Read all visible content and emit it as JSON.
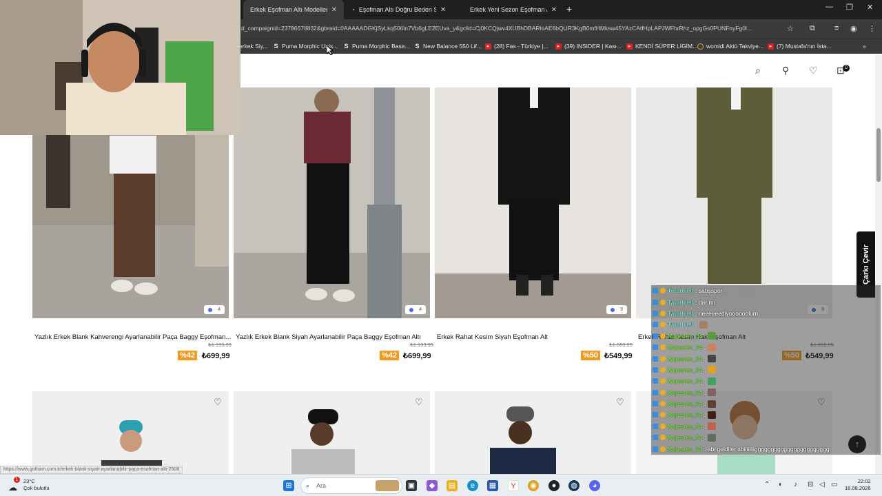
{
  "browser": {
    "tabs": [
      {
        "label": "Erkek Eşofman Altı Modelleri | G",
        "active": true
      },
      {
        "label": "Eşofman Altı Doğru Beden Seçi",
        "active": false
      },
      {
        "label": "Erkek Yeni Sezon Eşofman Altı",
        "active": false
      }
    ],
    "url": "d_campaignid=23786678832&gbraid=0AAAAADGKjSyLkq506in7Vb6gLE2EUva_y&gclid=Cj0KCQjwv4XUBhDBARIsAE6bQUR3KgB0mfHMksw45YAzCAtfHpLAPJWFhrRhz_opgGs0PUNFnyFg0l...",
    "bookmarks": [
      {
        "label": "erkek Siy...",
        "icon": "none"
      },
      {
        "label": "Puma Morphic Unis...",
        "icon": "S"
      },
      {
        "label": "Puma Morphic Base...",
        "icon": "S"
      },
      {
        "label": "New Balance 550 Lif...",
        "icon": "S"
      },
      {
        "label": "(28) Fas - Türkiye |...",
        "icon": "youtube"
      },
      {
        "label": "(39) INSIDER | Kası...",
        "icon": "youtube"
      },
      {
        "label": "KENDİ SÜPER LİGİM...",
        "icon": "youtube"
      },
      {
        "label": "womidi Aktü Takviye...",
        "icon": "o"
      },
      {
        "label": "(7) Mustafa'nın İsta...",
        "icon": "youtube"
      }
    ]
  },
  "site": {
    "cart_count": "0",
    "products_row1": [
      {
        "name": "Yazlık Erkek Blank Kahverengi Ayarlanabilir Paça Baggy Eşofman...",
        "old_price": "₺1.199,99",
        "discount": "%42",
        "price": "₺699,99",
        "colors": "4"
      },
      {
        "name": "Yazlık Erkek Blank Siyah Ayarlanabilir Paça Baggy Eşofman Altı",
        "old_price": "₺1.199,99",
        "discount": "%42",
        "price": "₺699,99",
        "colors": "4"
      },
      {
        "name": "Erkek Rahat Kesim Siyah Eşofman Alt",
        "old_price": "₺1.099,99",
        "discount": "%50",
        "price": "₺549,99",
        "colors": "9"
      },
      {
        "name": "Erkek Rahat Kesim Haki Eşofman Alt",
        "old_price": "₺1.099,99",
        "discount": "%50",
        "price": "₺549,99",
        "colors": "9"
      }
    ],
    "side_button": "Çarkı Çevir",
    "status_link": "https://www.gotham.com.tr/erkek-blank-siyah-ayarlanabilir-paca-esofman-alti-2508"
  },
  "chat": [
    {
      "user": "Tarathiell",
      "message": ": satışspor",
      "color": "teal"
    },
    {
      "user": "Tarathiell",
      "message": ": dar mı",
      "color": "teal"
    },
    {
      "user": "Tarathiell",
      "message": ": neeeeeediyoooooolum",
      "color": "teal"
    },
    {
      "user": "Tarathiell",
      "message": ":",
      "color": "teal",
      "emote": "#a88060"
    },
    {
      "user": "Majestee_34",
      "message": ":",
      "color": "green",
      "emote": "#5a9a40"
    },
    {
      "user": "Majestee_34",
      "message": ":",
      "color": "green",
      "emote": "#d08060"
    },
    {
      "user": "Majestee_34",
      "message": ":",
      "color": "green",
      "emote": "#444"
    },
    {
      "user": "Majestee_34",
      "message": ":",
      "color": "green",
      "emote": "#e0a020"
    },
    {
      "user": "Majestee_34",
      "message": ":",
      "color": "green",
      "emote": "#40a060"
    },
    {
      "user": "Majestee_34",
      "message": ":",
      "color": "green",
      "emote": "#806060"
    },
    {
      "user": "Majestee_34",
      "message": ":",
      "color": "green",
      "emote": "#604030"
    },
    {
      "user": "Majestee_34",
      "message": ":",
      "color": "green",
      "emote": "#402010"
    },
    {
      "user": "Majestee_34",
      "message": ":",
      "color": "green",
      "emote": "#c06050"
    },
    {
      "user": "Majestee_34",
      "message": ":",
      "color": "green",
      "emote": "#607060"
    },
    {
      "user": "Majestee_34",
      "message": ": abi geldiler abiiiiiiiiggggggggggggggggggggggg",
      "color": "green"
    }
  ],
  "taskbar": {
    "temperature": "23°C",
    "weather": "Çok bulutlu",
    "search_placeholder": "Ara",
    "time": "22:02",
    "date": "16.08.2026",
    "notification_count": "1"
  }
}
